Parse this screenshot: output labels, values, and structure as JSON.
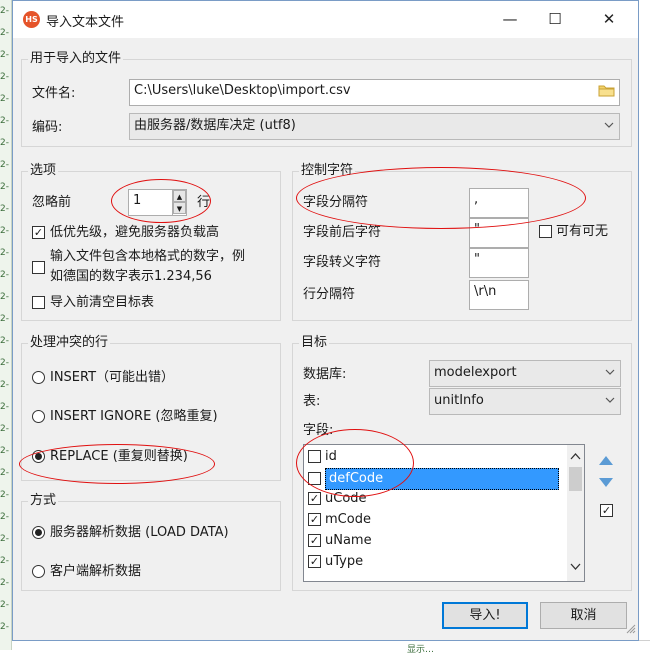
{
  "background_line_label": "2-",
  "background_status": "显示…",
  "window": {
    "title": "导入文本文件",
    "app_icon": "HS",
    "minimize": "—",
    "maximize": "☐",
    "close": "✕"
  },
  "file_group": {
    "title": "用于导入的文件",
    "filename_label": "文件名:",
    "filename_value": "C:\\Users\\luke\\Desktop\\import.csv",
    "encoding_label": "编码:",
    "encoding_value": "由服务器/数据库决定 (utf8)"
  },
  "options_group": {
    "title": "选项",
    "ignore_label": "忽略前",
    "ignore_value": "1",
    "ignore_unit": "行",
    "low_priority": {
      "label": "低优先级，避免服务器负载高",
      "checked": true
    },
    "local_number_line1": "输入文件包含本地格式的数字，例",
    "local_number_line2": "如德国的数字表示1.234,56",
    "local_number_checked": false,
    "truncate": {
      "label": "导入前清空目标表",
      "checked": false
    }
  },
  "control_group": {
    "title": "控制字符",
    "field_sep_label": "字段分隔符",
    "field_sep_value": ",",
    "enclosure_label": "字段前后字符",
    "enclosure_value": "\"",
    "optional_label": "可有可无",
    "optional_checked": false,
    "escape_label": "字段转义字符",
    "escape_value": "\"",
    "line_sep_label": "行分隔符",
    "line_sep_value": "\\r\\n"
  },
  "duplicates_group": {
    "title": "处理冲突的行",
    "options": [
      "INSERT（可能出错）",
      "INSERT IGNORE (忽略重复)",
      "REPLACE (重复则替换)"
    ],
    "selected": 2
  },
  "method_group": {
    "title": "方式",
    "options": [
      "服务器解析数据 (LOAD DATA)",
      "客户端解析数据"
    ],
    "selected": 0
  },
  "target_group": {
    "title": "目标",
    "database_label": "数据库:",
    "database_value": "modelexport",
    "table_label": "表:",
    "table_value": "unitInfo",
    "fields_label": "字段:",
    "fields": [
      {
        "name": "id",
        "checked": false,
        "selected": false
      },
      {
        "name": "defCode",
        "checked": false,
        "selected": true
      },
      {
        "name": "uCode",
        "checked": true,
        "selected": false
      },
      {
        "name": "mCode",
        "checked": true,
        "selected": false
      },
      {
        "name": "uName",
        "checked": true,
        "selected": false
      },
      {
        "name": "uType",
        "checked": true,
        "selected": false
      }
    ],
    "select_all_checked": true
  },
  "buttons": {
    "import": "导入!",
    "cancel": "取消"
  },
  "colors": {
    "annotation": "#e01010",
    "selection": "#3399ff",
    "move_arrow": "#5b9bd5"
  },
  "icons": {
    "folder": "folder-icon",
    "spin_up": "▲",
    "spin_down": "▼",
    "arrow_up": "▲",
    "arrow_down": "▼",
    "dropdown": "⌵"
  }
}
